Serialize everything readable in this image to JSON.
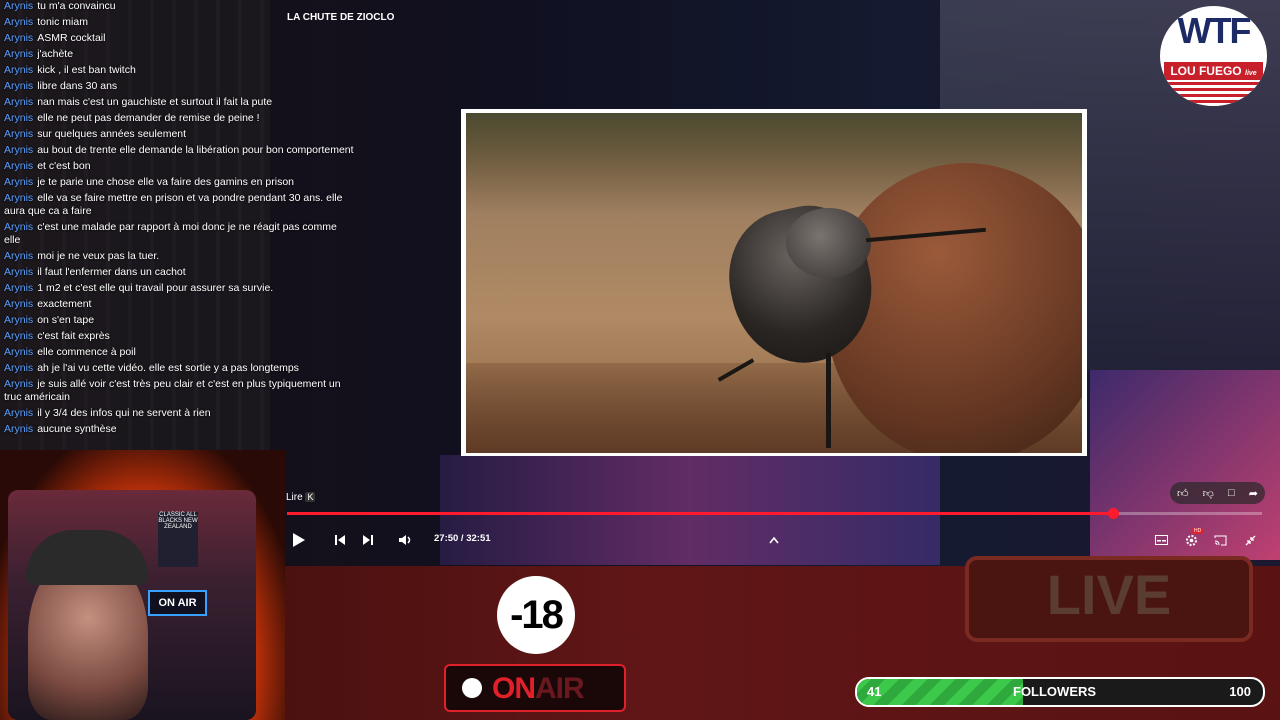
{
  "chat": {
    "messages": [
      {
        "user": "Arynis",
        "text": "tu m'a convaincu"
      },
      {
        "user": "Arynis",
        "text": "tonic miam"
      },
      {
        "user": "Arynis",
        "text": "ASMR cocktail"
      },
      {
        "user": "Arynis",
        "text": "j'achète"
      },
      {
        "user": "Arynis",
        "text": "kick , il est ban twitch"
      },
      {
        "user": "Arynis",
        "text": "libre dans 30 ans"
      },
      {
        "user": "Arynis",
        "text": "nan mais c'est un gauchiste et surtout il fait la pute"
      },
      {
        "user": "Arynis",
        "text": "elle ne peut pas demander de remise de peine !"
      },
      {
        "user": "Arynis",
        "text": "sur quelques années seulement"
      },
      {
        "user": "Arynis",
        "text": "au bout de trente elle demande la libération pour bon comportement"
      },
      {
        "user": "Arynis",
        "text": "et c'est bon"
      },
      {
        "user": "Arynis",
        "text": "je te parie une chose elle va faire des gamins en prison"
      },
      {
        "user": "Arynis",
        "text": "elle va se faire mettre en prison et va pondre pendant 30 ans. elle aura que ca a faire"
      },
      {
        "user": "Arynis",
        "text": "c'est une malade par rapport à moi donc je ne réagit pas comme elle"
      },
      {
        "user": "Arynis",
        "text": "moi je ne veux pas la tuer."
      },
      {
        "user": "Arynis",
        "text": "il faut l'enfermer dans un cachot"
      },
      {
        "user": "Arynis",
        "text": "1 m2 et c'est elle qui travail pour assurer sa survie."
      },
      {
        "user": "Arynis",
        "text": "exactement"
      },
      {
        "user": "Arynis",
        "text": "on s'en tape"
      },
      {
        "user": "Arynis",
        "text": "c'est fait exprès"
      },
      {
        "user": "Arynis",
        "text": "elle commence à poil"
      },
      {
        "user": "Arynis",
        "text": "ah je l'ai vu cette vidéo. elle est sortie y a pas longtemps"
      },
      {
        "user": "Arynis",
        "text": "je suis allé voir c'est très peu clair et c'est en plus typiquement un truc américain"
      },
      {
        "user": "Arynis",
        "text": "il y 3/4 des infos qui ne servent à rien"
      },
      {
        "user": "Arynis",
        "text": "aucune synthèse"
      }
    ]
  },
  "player": {
    "title": "LA CHUTE DE ZIOCLO",
    "tooltip_label": "Lire",
    "tooltip_key": "K",
    "time": "27:50 / 32:51",
    "progress": 0.847,
    "hd_badge": "HD"
  },
  "logo": {
    "main": "WTF",
    "sub": "LOU FUEGO",
    "small": "live"
  },
  "overlay": {
    "live_sign": "LIVE",
    "age_badge": "-18",
    "onair_on": "ON",
    "onair_air": "AIR",
    "webcam_sign": "ON AIR",
    "webcam_poster": "CLASSIC ALL BLACKS NEW ZEALAND"
  },
  "goal": {
    "current": "41",
    "label": "FOLLOWERS",
    "target": "100",
    "fraction": 0.41
  },
  "colors": {
    "accent_red": "#ff1a2e",
    "chat_user": "#5aa0ff",
    "goal_green": "#3cc84a"
  },
  "icons": {
    "play": "play-icon",
    "prev": "previous-icon",
    "next": "next-icon",
    "volume": "volume-icon",
    "chevron": "chevron-up-icon",
    "subtitles": "subtitles-icon",
    "settings": "gear-icon",
    "cast": "cast-icon",
    "exit": "exit-fullscreen-icon",
    "like": "thumbs-up-icon",
    "dislike": "thumbs-down-icon",
    "comment": "comment-icon",
    "share": "share-icon"
  }
}
